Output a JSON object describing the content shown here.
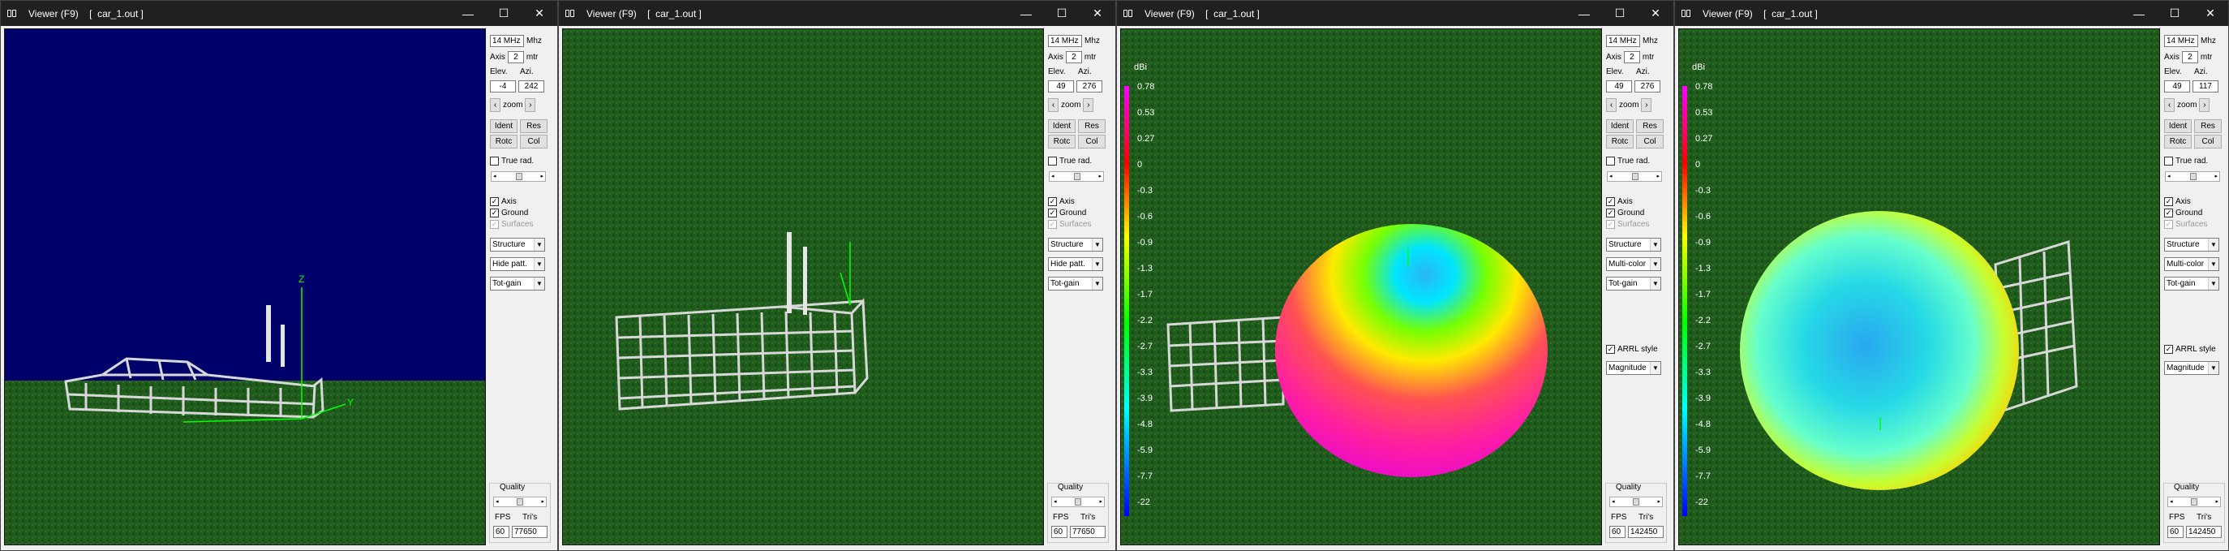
{
  "windows": [
    {
      "title": "Viewer (F9)    [  car_1.out ]",
      "freq": "14 MHz",
      "freq_unit": "Mhz",
      "axis_label": "Axis",
      "axis_value": "2",
      "axis_unit": "mtr",
      "elev_label": "Elev.",
      "azi_label": "Azi.",
      "elev": "-4",
      "azi": "242",
      "zoom_label": "zoom",
      "ident_label": "Ident",
      "res_label": "Res",
      "rotc_label": "Rotc",
      "col_label": "Col",
      "true_rad_label": "True rad.",
      "axis_chk": "Axis",
      "ground_chk": "Ground",
      "surfaces_chk": "Surfaces",
      "dd1": "Structure",
      "dd2": "Hide patt.",
      "dd3": "Tot-gain",
      "quality_label": "Quality",
      "fps_label": "FPS",
      "tris_label": "Tri's",
      "fps": "60",
      "tris": "77650"
    },
    {
      "title": "Viewer (F9)    [  car_1.out ]",
      "freq": "14 MHz",
      "freq_unit": "Mhz",
      "axis_label": "Axis",
      "axis_value": "2",
      "axis_unit": "mtr",
      "elev_label": "Elev.",
      "azi_label": "Azi.",
      "elev": "49",
      "azi": "276",
      "zoom_label": "zoom",
      "ident_label": "Ident",
      "res_label": "Res",
      "rotc_label": "Rotc",
      "col_label": "Col",
      "true_rad_label": "True rad.",
      "axis_chk": "Axis",
      "ground_chk": "Ground",
      "surfaces_chk": "Surfaces",
      "dd1": "Structure",
      "dd2": "Hide patt.",
      "dd3": "Tot-gain",
      "quality_label": "Quality",
      "fps_label": "FPS",
      "tris_label": "Tri's",
      "fps": "60",
      "tris": "77650"
    },
    {
      "title": "Viewer (F9)    [  car_1.out ]",
      "freq": "14 MHz",
      "freq_unit": "Mhz",
      "axis_label": "Axis",
      "axis_value": "2",
      "axis_unit": "mtr",
      "elev_label": "Elev.",
      "azi_label": "Azi.",
      "elev": "49",
      "azi": "276",
      "zoom_label": "zoom",
      "ident_label": "Ident",
      "res_label": "Res",
      "rotc_label": "Rotc",
      "col_label": "Col",
      "true_rad_label": "True rad.",
      "axis_chk": "Axis",
      "ground_chk": "Ground",
      "surfaces_chk": "Surfaces",
      "dd1": "Structure",
      "dd2": "Multi-color",
      "dd3": "Tot-gain",
      "arrl_label": "ARRL style",
      "dd4": "Magnitude",
      "quality_label": "Quality",
      "fps_label": "FPS",
      "tris_label": "Tri's",
      "fps": "60",
      "tris": "142450"
    },
    {
      "title": "Viewer (F9)    [  car_1.out ]",
      "freq": "14 MHz",
      "freq_unit": "Mhz",
      "axis_label": "Axis",
      "axis_value": "2",
      "axis_unit": "mtr",
      "elev_label": "Elev.",
      "azi_label": "Azi.",
      "elev": "49",
      "azi": "117",
      "zoom_label": "zoom",
      "ident_label": "Ident",
      "res_label": "Res",
      "rotc_label": "Rotc",
      "col_label": "Col",
      "true_rad_label": "True rad.",
      "axis_chk": "Axis",
      "ground_chk": "Ground",
      "surfaces_chk": "Surfaces",
      "dd1": "Structure",
      "dd2": "Multi-color",
      "dd3": "Tot-gain",
      "arrl_label": "ARRL style",
      "dd4": "Magnitude",
      "quality_label": "Quality",
      "fps_label": "FPS",
      "tris_label": "Tri's",
      "fps": "60",
      "tris": "142450"
    }
  ],
  "scale": {
    "unit": "dBi",
    "ticks": [
      "0.78",
      "0.53",
      "0.27",
      "0",
      "-0.3",
      "-0.6",
      "-0.9",
      "-1.3",
      "-1.7",
      "-2.2",
      "-2.7",
      "-3.3",
      "-3.9",
      "-4.8",
      "-5.9",
      "-7.7",
      "-22"
    ]
  },
  "axis_labels": {
    "z": "Z",
    "y": "Y"
  },
  "colors": {
    "sky": "#00006b",
    "grass": "#1f5a1c",
    "title_bar": "#202020",
    "panel": "#f0f0f0",
    "axis": "#00ff00"
  }
}
